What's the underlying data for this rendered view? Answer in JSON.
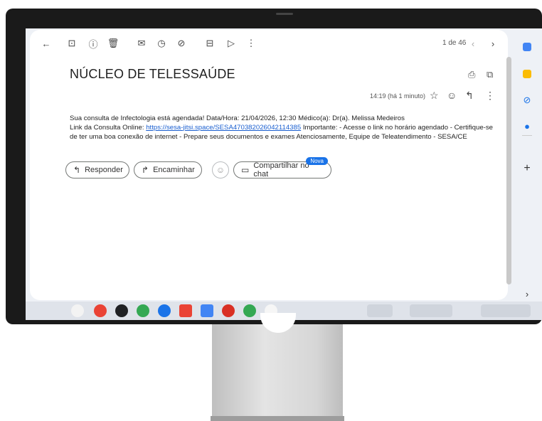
{
  "toolbar": {
    "pager": "1 de 46"
  },
  "email": {
    "subject": "NÚCLEO DE TELESSAÚDE",
    "time": "14:19 (há 1 minuto)",
    "body_line1": "Sua consulta de Infectologia está agendada! Data/Hora: 21/04/2026, 12:30 Médico(a): Dr(a). Melissa Medeiros",
    "body_prefix": "Link da Consulta Online: ",
    "link": "https://sesa-jitsi.space/SESA470382026042114385",
    "body_rest": " Importante: - Acesse o link no horário agendado - Certifique-se de ter uma boa conexão de internet - Prepare seus documentos e exames Atenciosamente, Equipe de Teleatendimento - SESA/CE"
  },
  "actions": {
    "reply": "Responder",
    "forward": "Encaminhar",
    "share": "Compartilhar no chat",
    "new_badge": "Nova"
  },
  "colors": {
    "link": "#1a5fd0",
    "badge": "#1a73e8",
    "bezel": "#1a1a1a",
    "screen_bg": "#eef1f6"
  },
  "icons": {
    "back": "arrow-left-icon",
    "archive": "archive-icon",
    "spam": "report-icon",
    "delete": "trash-icon",
    "unread": "mark-unread-icon",
    "snooze": "clock-icon",
    "task": "add-task-icon",
    "move": "move-to-icon",
    "label": "label-icon",
    "more": "more-vert-icon",
    "print": "print-icon",
    "open": "open-new-window-icon",
    "star": "star-icon",
    "emoji": "emoji-icon",
    "reply": "reply-icon"
  }
}
